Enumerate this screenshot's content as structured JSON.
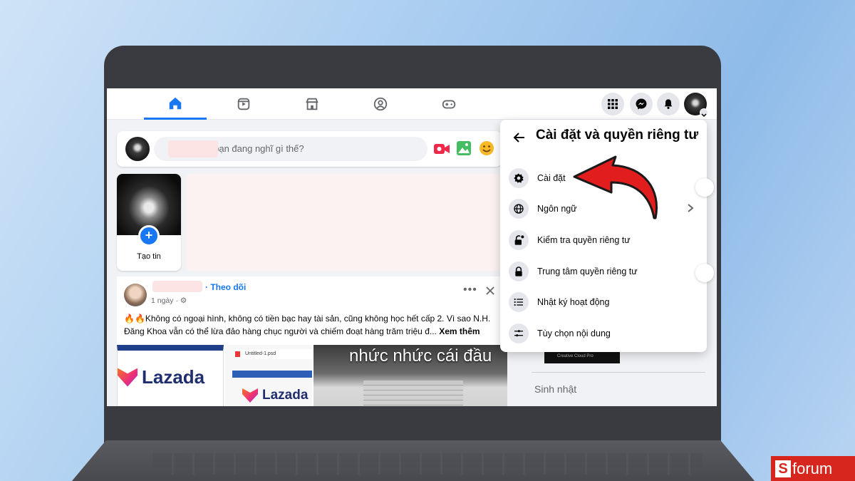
{
  "colors": {
    "brand": "#1877f2",
    "arrow": "#e11d1d",
    "badge": "#d7261e"
  },
  "topbar": {
    "tabs": [
      {
        "icon": "home-icon",
        "active": true
      },
      {
        "icon": "video-icon",
        "active": false
      },
      {
        "icon": "marketplace-icon",
        "active": false
      },
      {
        "icon": "groups-icon",
        "active": false
      },
      {
        "icon": "gaming-icon",
        "active": false
      }
    ],
    "right_icons": [
      "menu-grid-icon",
      "messenger-icon",
      "bell-icon",
      "account-avatar"
    ]
  },
  "composer": {
    "placeholder": "i, bạn đang nghĩ gì thế?"
  },
  "story": {
    "label": "Tạo tin"
  },
  "post": {
    "follow": "· Theo dõi",
    "time": "1 ngày · ",
    "text": "🔥🔥Không có ngoại hình, không có tiền bạc hay tài sản, cũng không học hết cấp 2. Vì sao N.H. Đăng Khoa vẫn có thể lừa đảo hàng chục người và chiếm đoạt hàng trăm triệu đ...",
    "see_more": "Xem thêm",
    "images": {
      "lazada1": "Lazada",
      "file_name": "Untitled-1.psd",
      "lazada2": "Lazada",
      "overlay_text": "nhức nhức cái đầu"
    }
  },
  "settings_menu": {
    "title": "Cài đặt và quyền riêng tư",
    "items": [
      {
        "label": "Cài đặt",
        "icon": "gear-icon"
      },
      {
        "label": "Ngôn ngữ",
        "icon": "globe-icon",
        "has_submenu": true
      },
      {
        "label": "Kiểm tra quyền riêng tư",
        "icon": "lock-check-icon"
      },
      {
        "label": "Trung tâm quyền riêng tư",
        "icon": "lock-icon"
      },
      {
        "label": "Nhật ký hoạt động",
        "icon": "list-icon"
      },
      {
        "label": "Tùy chọn nội dung",
        "icon": "content-preferences-icon"
      }
    ]
  },
  "right_column": {
    "ad_label": "Creative Cloud Pro",
    "birthday_heading": "Sinh nhật"
  },
  "watermark": {
    "brand": "forum"
  }
}
